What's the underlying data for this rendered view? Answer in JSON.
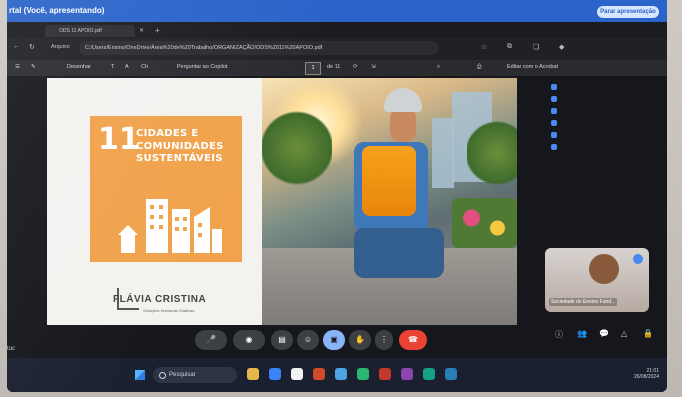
{
  "presenter": {
    "title": "rtal (Você, apresentando)",
    "stop_button": "Parar apresentação"
  },
  "browser": {
    "tab_title": "ODS 11 APOIO.pdf",
    "arquivo_label": "Arquivo",
    "address": "C:/Users/Ensino/OneDrive/Área%20de%20Trabalho/ORGANIZAÇÃO/ODS%2011%20APOIO.pdf"
  },
  "pdf_toolbar": {
    "draw_label": "Desenhar",
    "zoom_label": "Ch",
    "copilot_label": "Perguntar ao Copilot",
    "page_current": "1",
    "page_total": "de 11",
    "acrobat_label": "Editar com o Acrobat"
  },
  "slide": {
    "ods_number": "11",
    "ods_title": "CIDADES E\nCOMUNIDADES\nSUSTENTÁVEIS",
    "brand_name": "FLÁVIA CRISTINA",
    "brand_subtitle": "Soluções Humanas Criativas"
  },
  "video": {
    "label": "Sociedade do Ensino Fund..."
  },
  "left_tag": "tuc",
  "taskbar": {
    "search_placeholder": "Pesquisar",
    "time": "21:01",
    "date": "26/08/2024"
  },
  "colors": {
    "ods_orange": "#f1a24b",
    "presenter_blue": "#2a63c9",
    "end_call_red": "#ea4335"
  }
}
